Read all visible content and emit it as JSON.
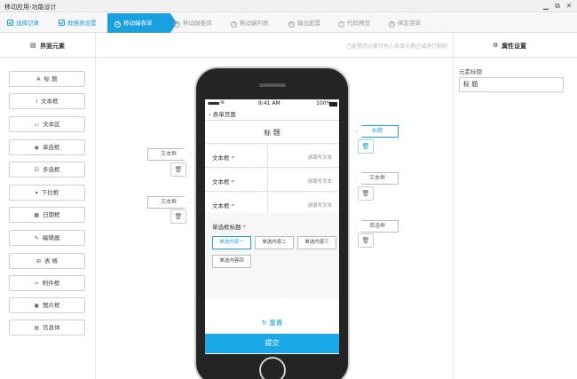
{
  "window": {
    "title": "移动应用-功能设计"
  },
  "steps": [
    {
      "label": "选择记录",
      "state": "done"
    },
    {
      "label": "数据表设置",
      "state": "done"
    },
    {
      "label": "移动端表单",
      "state": "current",
      "num": "3"
    },
    {
      "label": "移动端查询",
      "state": "todo",
      "num": "4"
    },
    {
      "label": "移动端列表",
      "state": "todo",
      "num": "5"
    },
    {
      "label": "输出配置",
      "state": "todo",
      "num": "6"
    },
    {
      "label": "代码预览",
      "state": "todo",
      "num": "7"
    },
    {
      "label": "绑定菜单",
      "state": "todo",
      "num": "8"
    }
  ],
  "left_panel": {
    "title": "界面元素",
    "components": [
      {
        "icon": "A",
        "label": "标 题"
      },
      {
        "icon": "I",
        "label": "文本框"
      },
      {
        "icon": "▭",
        "label": "文本区"
      },
      {
        "icon": "◉",
        "label": "单选框"
      },
      {
        "icon": "☑",
        "label": "多选框"
      },
      {
        "icon": "▾",
        "label": "下拉框"
      },
      {
        "icon": "▦",
        "label": "日期框"
      },
      {
        "icon": "✎",
        "label": "编辑器"
      },
      {
        "icon": "⊞",
        "label": "表 格"
      },
      {
        "icon": "✂",
        "label": "附件框"
      },
      {
        "icon": "▣",
        "label": "图片框"
      },
      {
        "icon": "▤",
        "label": "信息体"
      }
    ]
  },
  "center": {
    "hint": "已配置的元素可拖入表单元素区域进行删除"
  },
  "right_panel": {
    "title": "属性设置",
    "field_label": "元素标题",
    "field_value": "标 题"
  },
  "phone": {
    "status_time": "9:41 AM",
    "status_battery": "100%",
    "back_label": "表单页面",
    "form_title": "标 题",
    "fields": [
      {
        "label": "文本框",
        "placeholder": "请填写文本"
      },
      {
        "label": "文本框",
        "placeholder": "请填写文本"
      },
      {
        "label": "文本框",
        "placeholder": "请填写文本"
      }
    ],
    "radio_label": "单选框标题",
    "radio_options": [
      "单选内容一",
      "单选内容二",
      "单选内容三",
      "单选内容四"
    ],
    "reset_label": "重置",
    "submit_label": "提交"
  },
  "flags_left": [
    "文本框",
    "文本框"
  ],
  "flags_right": [
    "标题",
    "文本框",
    "单选框"
  ],
  "colors": {
    "accent": "#1a9fe0",
    "submit": "#1aa8e8"
  }
}
